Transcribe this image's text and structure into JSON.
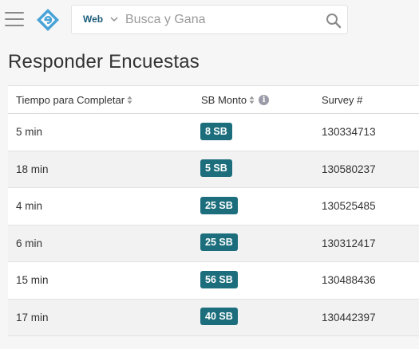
{
  "header": {
    "search": {
      "type_label": "Web",
      "placeholder": "Busca y Gana"
    }
  },
  "page": {
    "title": "Responder Encuestas"
  },
  "table": {
    "columns": {
      "time": "Tiempo para Completar",
      "amount": "SB Monto",
      "survey": "Survey #"
    },
    "rows": [
      {
        "time": "5 min",
        "amount": "8 SB",
        "survey": "130334713"
      },
      {
        "time": "18 min",
        "amount": "5 SB",
        "survey": "130580237"
      },
      {
        "time": "4 min",
        "amount": "25 SB",
        "survey": "130525485"
      },
      {
        "time": "6 min",
        "amount": "25 SB",
        "survey": "130312417"
      },
      {
        "time": "15 min",
        "amount": "56 SB",
        "survey": "130488436"
      },
      {
        "time": "17 min",
        "amount": "40 SB",
        "survey": "130442397"
      }
    ]
  },
  "colors": {
    "badge": "#1d6e7d",
    "logo": "#4aa3d6",
    "brand_text": "#1b5c7a"
  },
  "icons": [
    "menu-icon",
    "logo-icon",
    "chevron-down-icon",
    "search-icon",
    "sort-icon",
    "info-icon"
  ]
}
